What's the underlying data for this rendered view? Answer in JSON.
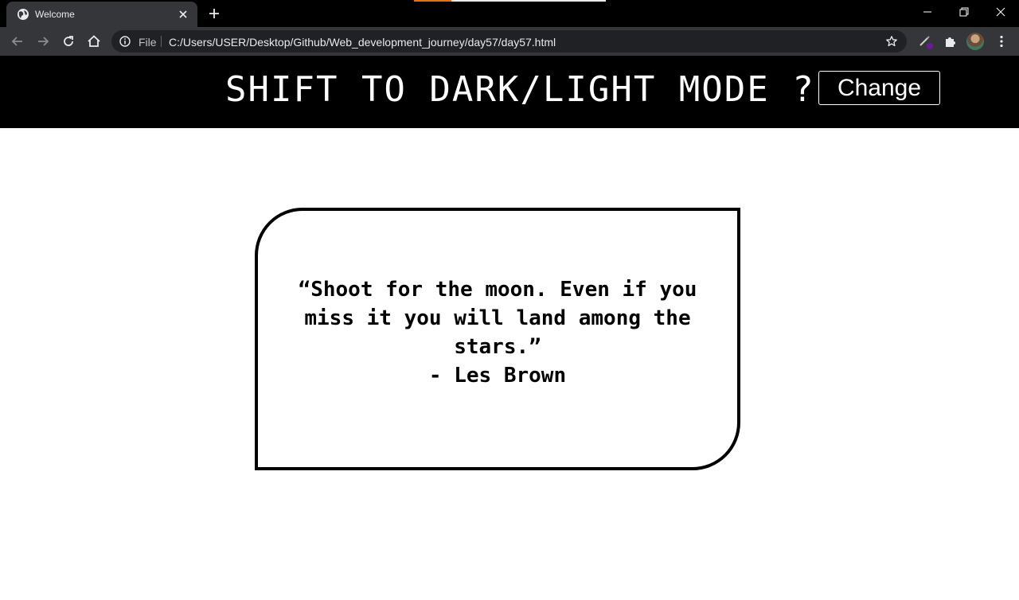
{
  "browser": {
    "tab": {
      "title": "Welcome"
    },
    "omnibox": {
      "scheme_label": "File",
      "url": "C:/Users/USER/Desktop/Github/Web_development_journey/day57/day57.html"
    },
    "colors": {
      "chrome_bg": "#35363a",
      "tabstrip_bg": "#000000",
      "omnibox_bg": "#202124",
      "load_accent": "#e8710a"
    }
  },
  "page": {
    "heading": "SHIFT TO DARK/LIGHT MODE ?",
    "change_button": "Change",
    "quote": {
      "text": "“Shoot for the moon. Even if you miss it you will land among the stars.”",
      "author": "- Les Brown"
    }
  }
}
